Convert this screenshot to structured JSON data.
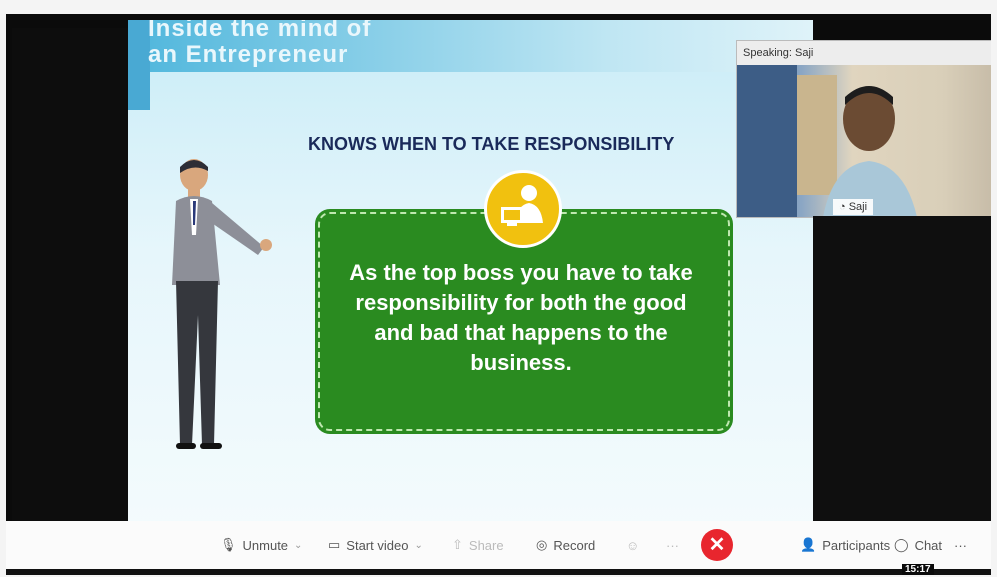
{
  "slide": {
    "title_line1": "Inside the mind of",
    "title_line2": "an  Entrepreneur",
    "heading": "KNOWS WHEN TO TAKE RESPONSIBILITY",
    "body": "As the top boss you have to take responsibility for both the good and bad that happens to the business."
  },
  "video": {
    "speaking_label": "Speaking:",
    "speaker": "Saji",
    "tile_name": "Saji"
  },
  "toolbar": {
    "unmute": "Unmute",
    "start_video": "Start video",
    "share": "Share",
    "record": "Record",
    "participants": "Participants",
    "chat": "Chat",
    "more": "···",
    "end_symbol": "✕"
  },
  "clock": "15:17",
  "colors": {
    "card_green": "#2a8b20",
    "badge_yellow": "#f1c10f",
    "end_red": "#e8262e"
  }
}
